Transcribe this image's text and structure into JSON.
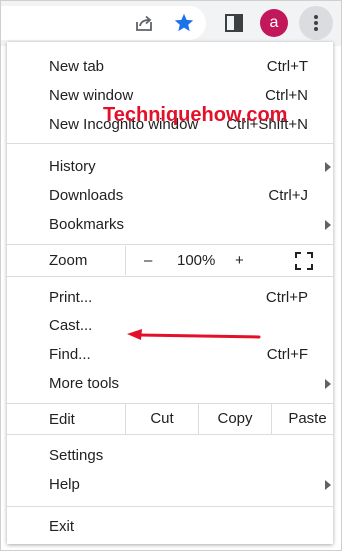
{
  "toolbar": {
    "icons": [
      "share-icon",
      "bookmark-star-icon",
      "side-panel-icon",
      "more-vert-icon"
    ],
    "avatar_letter": "a",
    "colors": {
      "star": "#1a73e8",
      "avatar": "#c2185b",
      "toolbar_bg": "#f1f3f4"
    }
  },
  "menu": {
    "new_tab": {
      "label": "New tab",
      "shortcut": "Ctrl+T"
    },
    "new_window": {
      "label": "New window",
      "shortcut": "Ctrl+N"
    },
    "new_incognito": {
      "label": "New Incognito window",
      "shortcut": "Ctrl+Shift+N"
    },
    "history": {
      "label": "History"
    },
    "downloads": {
      "label": "Downloads",
      "shortcut": "Ctrl+J"
    },
    "bookmarks": {
      "label": "Bookmarks"
    },
    "zoom": {
      "label": "Zoom",
      "minus": "–",
      "value": "100%",
      "plus": "+"
    },
    "print": {
      "label": "Print...",
      "shortcut": "Ctrl+P"
    },
    "cast": {
      "label": "Cast..."
    },
    "find": {
      "label": "Find...",
      "shortcut": "Ctrl+F"
    },
    "more_tools": {
      "label": "More tools"
    },
    "edit": {
      "label": "Edit",
      "cut": "Cut",
      "copy": "Copy",
      "paste": "Paste"
    },
    "settings": {
      "label": "Settings"
    },
    "help": {
      "label": "Help"
    },
    "exit": {
      "label": "Exit"
    }
  },
  "watermark": {
    "text": "Techniquehow.com",
    "color": "#e4102a"
  }
}
